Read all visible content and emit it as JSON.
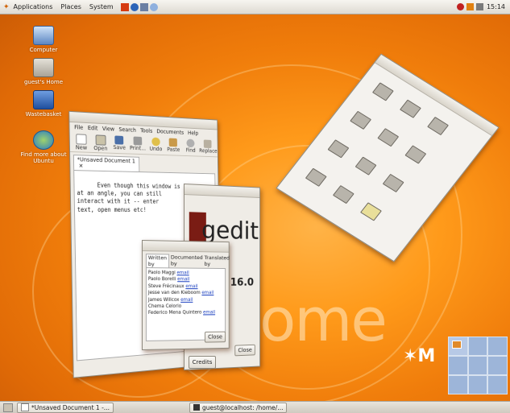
{
  "top_panel": {
    "applications": "Applications",
    "places": "Places",
    "system": "System",
    "clock": "15:14"
  },
  "desktop_icons": [
    {
      "label": "Computer"
    },
    {
      "label": "guest's Home"
    },
    {
      "label": "Wastebasket"
    },
    {
      "label": "Find more about Ubuntu"
    }
  ],
  "gedit": {
    "menu": [
      "File",
      "Edit",
      "View",
      "Search",
      "Tools",
      "Documents",
      "Help"
    ],
    "toolbar": [
      "New",
      "Open",
      "Save",
      "Print...",
      "Undo",
      "",
      "",
      "",
      "Paste",
      "Find",
      "Replace"
    ],
    "tab_label": "*Unsaved Document 1",
    "text": "Even though this window is\nat an angle, you can still\ninteract with it -- enter\ntext, open menus etc!"
  },
  "about": {
    "logo_text": "gedit",
    "version": "16.0",
    "credits_button": "Credits",
    "close_button": "Close"
  },
  "credits": {
    "tab_label": "Written by",
    "tab2": "Documented by",
    "tab3": "Translated by",
    "names": [
      "Paolo Maggi",
      "Paolo Borelli",
      "Steve Frécinaux",
      "Jesse van den Kieboom",
      "James Willcox",
      "Chema Celorio",
      "Federico Mena Quintero"
    ],
    "close_button": "Close"
  },
  "taskbar": [
    {
      "label": "*Unsaved Document 1 -..."
    },
    {
      "label": "guest@localhost: /home/..."
    }
  ],
  "brand_text": "ome",
  "colors": {
    "desktop": "#f07d0b",
    "link": "#1a3fbf",
    "pager": "#9db5d9"
  }
}
